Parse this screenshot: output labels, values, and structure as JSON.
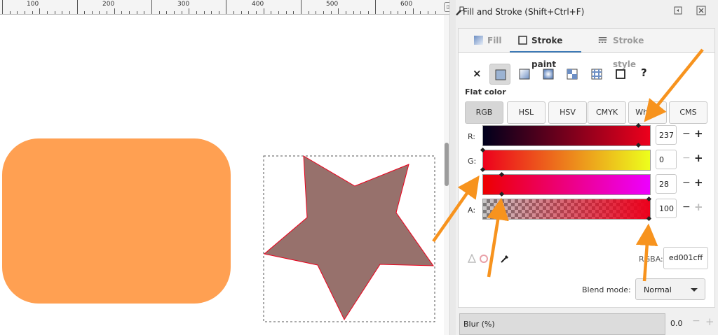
{
  "ruler": {
    "labels": [
      "100",
      "200",
      "300",
      "400",
      "500",
      "600"
    ]
  },
  "canvas": {
    "rounded_rect_fill": "#ffa052",
    "star_fill": "#97716c",
    "star_stroke": "#ed001c"
  },
  "dialog": {
    "title": "Fill and Stroke (Shift+Ctrl+F)",
    "tabs": {
      "fill": "Fill",
      "stroke_paint": "Stroke paint",
      "stroke_style": "Stroke style"
    },
    "paint_types": [
      "No paint",
      "Flat color",
      "Linear gradient",
      "Radial gradient",
      "Pattern",
      "Swatch",
      "Mesh",
      "Unset"
    ],
    "no_paint_glyph": "×",
    "unset_glyph": "?",
    "flat_color_label": "Flat color",
    "modes": [
      "RGB",
      "HSL",
      "HSV",
      "CMYK",
      "Wheel",
      "CMS"
    ],
    "active_mode": "RGB",
    "channels": {
      "r": {
        "label": "R:",
        "value": "237"
      },
      "g": {
        "label": "G:",
        "value": "0"
      },
      "b": {
        "label": "B:",
        "value": "28"
      },
      "a": {
        "label": "A:",
        "value": "100"
      }
    },
    "minus_glyph": "−",
    "plus_glyph": "+",
    "rgba_label": "RGBA:",
    "rgba_value": "ed001cff",
    "blend_label": "Blend mode:",
    "blend_value": "Normal",
    "blur_label": "Blur (%)",
    "blur_value": "0.0",
    "colors": {
      "accent": "#3c7ab7",
      "arrow": "#f7931e",
      "current_color": "#ed001c"
    }
  }
}
